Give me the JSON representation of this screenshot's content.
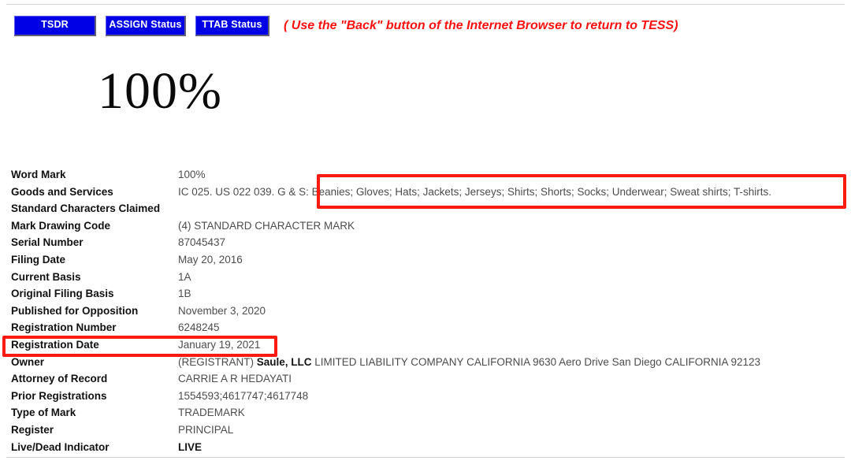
{
  "toolbar": {
    "buttons": [
      {
        "label": "TSDR",
        "name": "tsdr-button"
      },
      {
        "label": "ASSIGN Status",
        "name": "assign-status-button"
      },
      {
        "label": "TTAB Status",
        "name": "ttab-status-button"
      }
    ],
    "note": "( Use the \"Back\" button of the Internet Browser to return to TESS)",
    "note_color": "#ff1111",
    "button_color": "#0000e6"
  },
  "mark_display": {
    "text": "100%"
  },
  "record": {
    "rows": [
      {
        "label": "Word Mark",
        "value": "100%"
      },
      {
        "label": "Goods and Services",
        "value": "IC 025. US 022 039. G & S: Beanies; Gloves; Hats; Jackets; Jerseys; Shirts; Shorts; Socks; Underwear; Sweat shirts; T-shirts."
      },
      {
        "label": "Standard Characters Claimed",
        "value": ""
      },
      {
        "label": "Mark Drawing Code",
        "value": "(4) STANDARD CHARACTER MARK"
      },
      {
        "label": "Serial Number",
        "value": "87045437"
      },
      {
        "label": "Filing Date",
        "value": "May 20, 2016"
      },
      {
        "label": "Current Basis",
        "value": "1A"
      },
      {
        "label": "Original Filing Basis",
        "value": "1B"
      },
      {
        "label": "Published for Opposition",
        "value": "November 3, 2020"
      },
      {
        "label": "Registration Number",
        "value": "6248245"
      },
      {
        "label": "Registration Date",
        "value": "January 19, 2021"
      },
      {
        "label": "Owner",
        "value": "(REGISTRANT) Saule, LLC LIMITED LIABILITY COMPANY CALIFORNIA 9630 Aero Drive San Diego CALIFORNIA 92123",
        "bold_part": "Saule, LLC",
        "value_prefix": "(REGISTRANT) ",
        "value_suffix": " LIMITED LIABILITY COMPANY CALIFORNIA 9630 Aero Drive San Diego CALIFORNIA 92123"
      },
      {
        "label": "Attorney of Record",
        "value": "CARRIE A R HEDAYATI"
      },
      {
        "label": "Prior Registrations",
        "value": "1554593;4617747;4617748"
      },
      {
        "label": "Type of Mark",
        "value": "TRADEMARK"
      },
      {
        "label": "Register",
        "value": "PRINCIPAL"
      },
      {
        "label": "Live/Dead Indicator",
        "value": "LIVE",
        "bold_value": true
      }
    ]
  },
  "annotations": {
    "color": "#fc1a11",
    "boxes": [
      {
        "name": "goods-and-services-highlight",
        "target": "Goods and Services"
      },
      {
        "name": "registration-date-highlight",
        "target": "Registration Date"
      }
    ]
  }
}
